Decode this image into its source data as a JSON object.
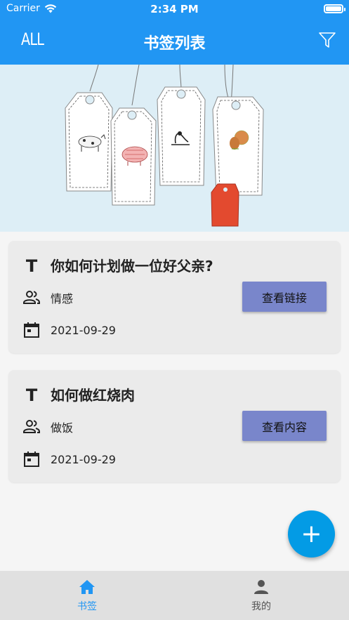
{
  "status_bar": {
    "carrier": "Carrier",
    "time": "2:34 PM"
  },
  "app_bar": {
    "left_label": "ALL",
    "title": "书签列表",
    "filter_icon": "filter-icon"
  },
  "colors": {
    "primary": "#2196f3",
    "button": "#7986cb",
    "fab": "#039be5",
    "card": "#ebebeb"
  },
  "bookmarks": [
    {
      "type_icon": "T",
      "title": "你如何计划做一位好父亲?",
      "category": "情感",
      "date": "2021-09-29",
      "action_label": "查看链接"
    },
    {
      "type_icon": "T",
      "title": "如何做红烧肉",
      "category": "做饭",
      "date": "2021-09-29",
      "action_label": "查看内容"
    }
  ],
  "fab": {
    "label": "+"
  },
  "bottom_nav": [
    {
      "label": "书签",
      "icon": "home-icon",
      "active": true
    },
    {
      "label": "我的",
      "icon": "person-icon",
      "active": false
    }
  ]
}
